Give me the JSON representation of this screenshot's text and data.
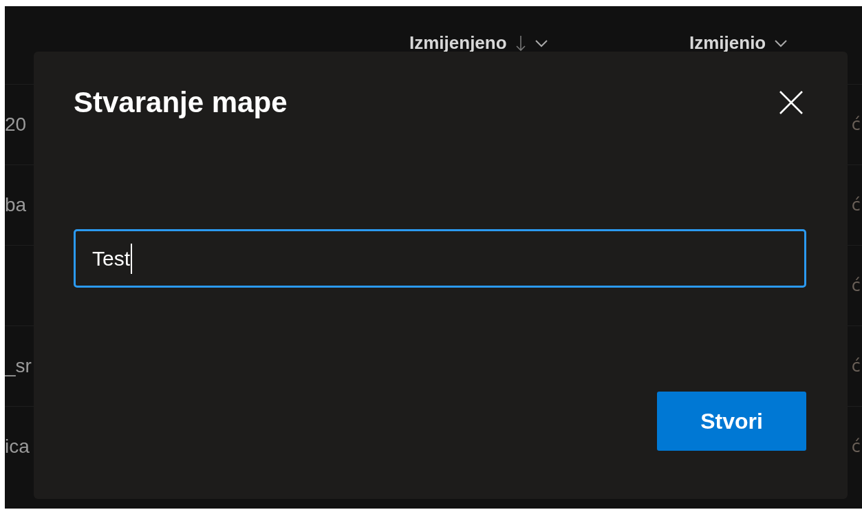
{
  "list": {
    "columns": [
      {
        "label": "Izmijenjeno",
        "sorted": true
      },
      {
        "label": "Izmijenio",
        "sorted": false
      }
    ],
    "rows": [
      {
        "column_1": "20",
        "column_2": "ć"
      },
      {
        "column_1": "ba",
        "column_2": "ć"
      },
      {
        "column_2": "ć"
      },
      {
        "column_1": "_sr",
        "column_2": "ć"
      },
      {
        "column_1": "ica",
        "column_2": "ć"
      }
    ]
  },
  "dialog": {
    "title": "Stvaranje mape",
    "field": {
      "value": "Test",
      "focused": true
    },
    "button": "Stvori"
  }
}
